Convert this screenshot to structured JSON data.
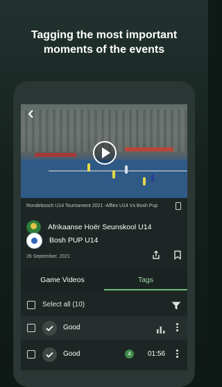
{
  "headline": {
    "line1": "Tagging the most important",
    "line2": "moments of the events"
  },
  "video": {
    "title": "Rondebosch U14 Tournament 2021 -Affies U14 Vs Bosh Pup",
    "back_icon": "back-arrow-icon",
    "play_icon": "play-icon",
    "cast_icon": "cast-icon"
  },
  "teams": [
    {
      "name": "Afrikaanse Hoër Seunskool U14",
      "logo": "team-crest-logo"
    },
    {
      "name": "Bosh PUP U14",
      "logo": "team-crest-logo"
    }
  ],
  "date": "26 September, 2021",
  "actions": {
    "share_icon": "share-icon",
    "bookmark_icon": "bookmark-icon"
  },
  "tabs": [
    {
      "label": "Game Videos",
      "active": false
    },
    {
      "label": "Tags",
      "active": true
    }
  ],
  "select_all": {
    "label": "Select all (10)",
    "checked": false
  },
  "tag_rows": [
    {
      "label": "Good",
      "checked": false,
      "count": "",
      "duration": "",
      "icon": "stats-icon"
    },
    {
      "label": "Good",
      "checked": false,
      "count": "4",
      "duration": "01:56",
      "icon": ""
    }
  ],
  "colors": {
    "accent": "#6fbf76",
    "badge": "#3c8a48",
    "background": "#0f1a17",
    "panel": "#1d2624"
  }
}
